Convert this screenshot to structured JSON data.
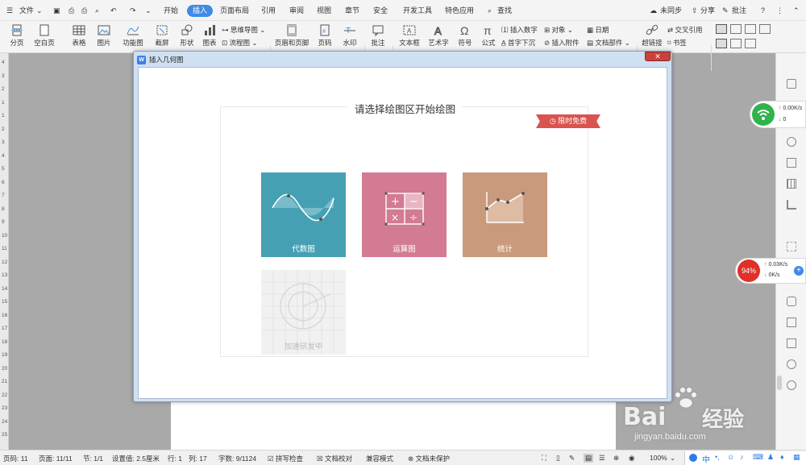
{
  "menubar": {
    "file_label": "文件",
    "tabs": [
      "开始",
      "插入",
      "页面布局",
      "引用",
      "审阅",
      "视图",
      "章节",
      "安全",
      "开发工具",
      "特色应用"
    ],
    "active_tab": "插入",
    "search_label": "查找",
    "sync_label": "未同步",
    "share_label": "分享",
    "comment_label": "批注"
  },
  "ribbon": {
    "page_break": "分页",
    "blank_page": "空白页",
    "table": "表格",
    "picture": "图片",
    "function_chart": "功能图",
    "screenshot": "截屏",
    "shape": "形状",
    "chart": "图表",
    "mind_map": "思维导图",
    "flowchart": "流程图",
    "header_footer": "页眉和页脚",
    "page_number": "页码",
    "watermark": "水印",
    "comment": "批注",
    "text_box": "文本框",
    "art_text": "艺术字",
    "symbol": "符号",
    "formula": "公式",
    "insert_number": "插入数字",
    "object": "对象",
    "date": "日期",
    "drop_cap": "首字下沉",
    "insert_attachment": "插入附件",
    "doc_parts": "文档部件",
    "hyperlink": "超链接",
    "cross_ref": "交叉引用",
    "bookmark": "书签"
  },
  "ruler": {
    "numbers": [
      "4",
      "3",
      "2",
      "1",
      "1",
      "2",
      "3",
      "4",
      "5",
      "6",
      "7",
      "8",
      "9",
      "10",
      "11",
      "12",
      "13",
      "14",
      "15",
      "16",
      "17",
      "18",
      "19",
      "20",
      "21",
      "22",
      "23",
      "24",
      "25"
    ]
  },
  "dialog": {
    "title": "插入几何图",
    "close": "✕",
    "heading": "请选择绘图区开始绘图",
    "badge": "限时免费",
    "tiles": [
      {
        "label": "代数图",
        "color": "#45a0b4"
      },
      {
        "label": "运算图",
        "color": "#d27b92"
      },
      {
        "label": "统计",
        "color": "#c99a7c"
      },
      {
        "label": "加速研发中",
        "color": "#f0f0f0"
      }
    ]
  },
  "net_widget_1": {
    "up": "0.00K/s",
    "down": "0"
  },
  "net_widget_2": {
    "percent": "94%",
    "up": "0.03K/s",
    "down": "0K/s"
  },
  "statusbar": {
    "page_code": "页码: 11",
    "page": "页面: 11/11",
    "section": "节: 1/1",
    "setting": "设置值: 2.5厘米",
    "row": "行: 1",
    "col": "列: 17",
    "word_count": "字数: 9/1124",
    "spell_check": "拼写检查",
    "doc_proof": "文档校对",
    "compat_mode": "兼容模式",
    "doc_protect": "文档未保护",
    "zoom": "100%"
  },
  "watermark": {
    "brand": "Bai",
    "brand2": "经验",
    "url": "jingyan.baidu.com"
  },
  "tray": {
    "lang": "中"
  }
}
